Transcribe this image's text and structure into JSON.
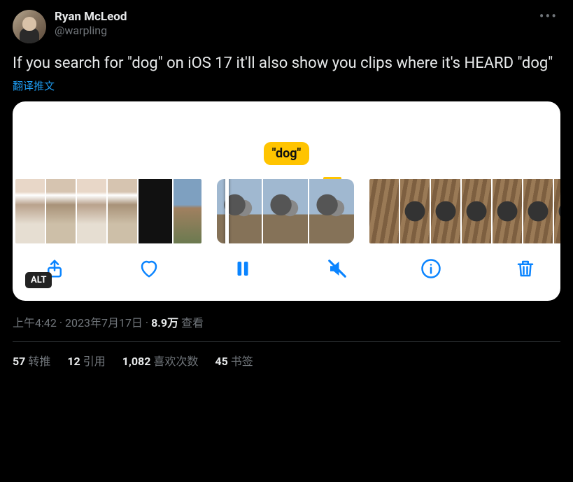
{
  "author": {
    "display_name": "Ryan McLeod",
    "handle": "@warpling"
  },
  "tweet_text": "If you search for \"dog\" on iOS 17 it'll also show you clips where it's HEARD \"dog\"",
  "translate_label": "翻译推文",
  "media": {
    "search_tag": "\"dog\"",
    "alt_badge": "ALT"
  },
  "meta": {
    "time": "上午4:42",
    "date": "2023年7月17日",
    "views_count": "8.9万",
    "views_label": "查看"
  },
  "stats": {
    "retweets_count": "57",
    "retweets_label": "转推",
    "quotes_count": "12",
    "quotes_label": "引用",
    "likes_count": "1,082",
    "likes_label": "喜欢次数",
    "bookmarks_count": "45",
    "bookmarks_label": "书签"
  }
}
